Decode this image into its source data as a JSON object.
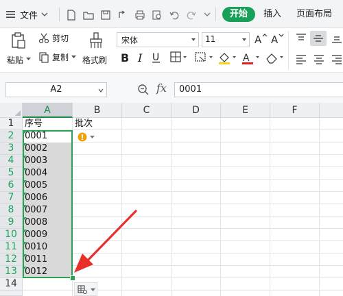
{
  "app": {
    "file_menu": "文件",
    "tabs": [
      "开始",
      "插入",
      "页面布局"
    ]
  },
  "ribbon": {
    "paste": "粘贴",
    "cut": "剪切",
    "copy": "复制",
    "format_painter": "格式刷",
    "font_name": "宋体",
    "font_size": "11"
  },
  "formula_bar": {
    "name_box": "A2",
    "fx": "fx",
    "value": "0001"
  },
  "sheet": {
    "columns": [
      "A",
      "B",
      "C",
      "D",
      "E",
      "F"
    ],
    "rows": [
      "1",
      "2",
      "3",
      "4",
      "5",
      "6",
      "7",
      "8",
      "9",
      "10",
      "11",
      "12",
      "13",
      "14"
    ],
    "header_A": "序号",
    "header_B": "批次",
    "values": [
      "0001",
      "0002",
      "0003",
      "0004",
      "0005",
      "0006",
      "0007",
      "0008",
      "0009",
      "0010",
      "0011",
      "0012"
    ]
  },
  "colors": {
    "accent": "#18a058",
    "selection": "#2aa155",
    "annotation_arrow": "#e8302a"
  }
}
